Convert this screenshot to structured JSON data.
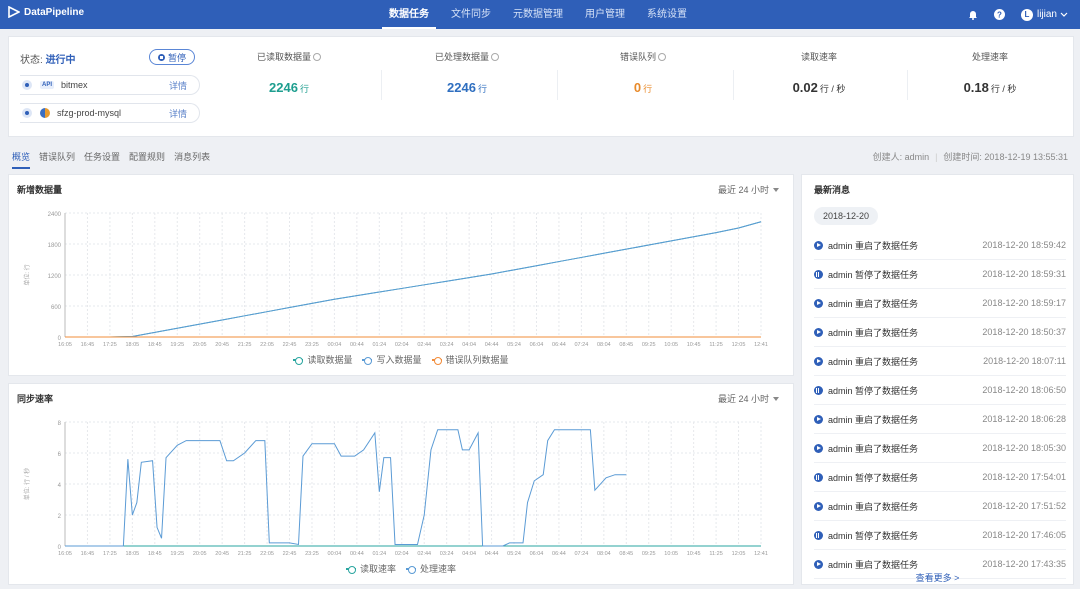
{
  "app": {
    "title": "DataPipeline"
  },
  "nav": {
    "items": [
      {
        "label": "数据任务",
        "active": true
      },
      {
        "label": "文件同步",
        "active": false
      },
      {
        "label": "元数据管理",
        "active": false
      },
      {
        "label": "用户管理",
        "active": false
      },
      {
        "label": "系统设置",
        "active": false
      }
    ],
    "user": "lijian"
  },
  "status": {
    "prefix": "状态:",
    "value": "进行中",
    "pause_label": "暂停",
    "sources": [
      {
        "badge": "API",
        "name": "bitmex",
        "detail": "详情"
      },
      {
        "name": "sfzg-prod-mysql",
        "detail": "详情"
      }
    ]
  },
  "metrics": [
    {
      "label": "已读取数据量",
      "value": "2246",
      "unit": "行",
      "color": "#1e9e8f",
      "info": true
    },
    {
      "label": "已处理数据量",
      "value": "2246",
      "unit": "行",
      "color": "#2f6fc0",
      "info": true
    },
    {
      "label": "错误队列",
      "value": "0",
      "unit": "行",
      "color": "#e88a2a",
      "info": true
    },
    {
      "label": "读取速率",
      "value": "0.02",
      "unit": "行 / 秒",
      "color": "#333333",
      "info": false
    },
    {
      "label": "处理速率",
      "value": "0.18",
      "unit": "行 / 秒",
      "color": "#333333",
      "info": false
    }
  ],
  "tabs": [
    "概览",
    "错误队列",
    "任务设置",
    "配置规则",
    "消息列表"
  ],
  "creator": {
    "creator": "创建人: admin",
    "created": "创建时间: 2018-12-19 13:55:31"
  },
  "chart1_panel": {
    "title": "新增数据量",
    "range": "最近 24 小时"
  },
  "chart2_panel": {
    "title": "同步速率",
    "range": "最近 24 小时"
  },
  "chart_data": [
    {
      "type": "line",
      "title": "新增数据量",
      "ylabel": "单位: 行",
      "ylim": [
        0,
        2400
      ],
      "yticks": [
        0,
        600,
        1200,
        1800,
        2400
      ],
      "x": [
        "16:05",
        "16:45",
        "17:25",
        "18:05",
        "18:45",
        "19:25",
        "20:05",
        "20:45",
        "21:25",
        "22:05",
        "22:45",
        "23:25",
        "00:04",
        "00:44",
        "01:24",
        "02:04",
        "02:44",
        "03:24",
        "04:04",
        "04:44",
        "05:24",
        "06:04",
        "06:44",
        "07:24",
        "08:04",
        "08:45",
        "09:25",
        "10:05",
        "10:45",
        "11:25",
        "12:05",
        "12:41"
      ],
      "grid": true,
      "legend": "bottom",
      "series": [
        {
          "name": "读取数据量",
          "color": "#2aa6a0",
          "values": [
            0,
            0,
            0,
            10,
            90,
            170,
            250,
            330,
            410,
            490,
            570,
            650,
            730,
            800,
            870,
            940,
            1010,
            1080,
            1150,
            1220,
            1300,
            1380,
            1460,
            1540,
            1620,
            1700,
            1780,
            1860,
            1940,
            2020,
            2110,
            2230
          ]
        },
        {
          "name": "写入数据量",
          "color": "#5b9bd5",
          "values": [
            0,
            0,
            0,
            10,
            90,
            170,
            250,
            330,
            410,
            490,
            570,
            650,
            730,
            800,
            870,
            940,
            1010,
            1080,
            1150,
            1220,
            1300,
            1380,
            1460,
            1540,
            1620,
            1700,
            1780,
            1860,
            1940,
            2020,
            2110,
            2230
          ]
        },
        {
          "name": "错误队列数据量",
          "color": "#f28c3a",
          "values": [
            0,
            0,
            0,
            0,
            0,
            0,
            0,
            0,
            0,
            0,
            0,
            0,
            0,
            0,
            0,
            0,
            0,
            0,
            0,
            0,
            0,
            0,
            0,
            0,
            0,
            0,
            0,
            0,
            0,
            0,
            0,
            0
          ]
        }
      ]
    },
    {
      "type": "line",
      "title": "同步速率",
      "ylabel": "单位: 行 / 秒",
      "ylim": [
        0,
        8
      ],
      "yticks": [
        0,
        2,
        4,
        6,
        8
      ],
      "x": [
        "16:05",
        "16:45",
        "17:25",
        "18:05",
        "18:45",
        "19:25",
        "20:05",
        "20:45",
        "21:25",
        "22:05",
        "22:45",
        "23:25",
        "00:04",
        "00:44",
        "01:24",
        "02:04",
        "02:44",
        "03:24",
        "04:04",
        "04:44",
        "05:24",
        "06:04",
        "06:44",
        "07:24",
        "08:04",
        "08:45",
        "09:25",
        "10:05",
        "10:45",
        "11:25",
        "12:05",
        "12:41"
      ],
      "grid": true,
      "legend": "bottom",
      "series": [
        {
          "name": "读取速率",
          "color": "#2aa6a0",
          "points": [
            [
              0,
              0
            ],
            [
              31,
              0
            ]
          ]
        },
        {
          "name": "处理速率",
          "color": "#5b9bd5",
          "points": [
            [
              0,
              0
            ],
            [
              2.6,
              0
            ],
            [
              2.8,
              5.6
            ],
            [
              3.0,
              2.0
            ],
            [
              3.2,
              2.8
            ],
            [
              3.4,
              5.4
            ],
            [
              3.9,
              5.5
            ],
            [
              4.1,
              1.2
            ],
            [
              4.3,
              0.5
            ],
            [
              4.5,
              5.7
            ],
            [
              5.0,
              6.5
            ],
            [
              5.4,
              6.8
            ],
            [
              6.5,
              6.8
            ],
            [
              6.9,
              6.8
            ],
            [
              7.2,
              5.5
            ],
            [
              7.5,
              5.5
            ],
            [
              8.0,
              6.0
            ],
            [
              8.5,
              6.8
            ],
            [
              8.9,
              6.8
            ],
            [
              9.1,
              0.2
            ],
            [
              10.0,
              0.2
            ],
            [
              10.4,
              0.1
            ],
            [
              10.6,
              5.8
            ],
            [
              11.0,
              6.6
            ],
            [
              12.0,
              6.6
            ],
            [
              12.3,
              5.8
            ],
            [
              12.9,
              5.8
            ],
            [
              13.3,
              6.2
            ],
            [
              13.8,
              7.3
            ],
            [
              14.0,
              3.5
            ],
            [
              14.2,
              5.7
            ],
            [
              14.5,
              5.7
            ],
            [
              14.7,
              0.1
            ],
            [
              15.7,
              0.1
            ],
            [
              16.0,
              2.0
            ],
            [
              16.3,
              6.2
            ],
            [
              16.6,
              7.5
            ],
            [
              17.5,
              7.5
            ],
            [
              17.7,
              6.2
            ],
            [
              18.0,
              6.2
            ],
            [
              18.4,
              7.3
            ],
            [
              18.6,
              0.0
            ],
            [
              19.5,
              0.0
            ],
            [
              19.8,
              0.2
            ],
            [
              20.4,
              0.2
            ],
            [
              20.6,
              2.8
            ],
            [
              20.9,
              4.2
            ],
            [
              21.3,
              4.6
            ],
            [
              21.5,
              6.8
            ],
            [
              21.8,
              7.5
            ],
            [
              23.4,
              7.5
            ],
            [
              23.6,
              3.6
            ],
            [
              24.1,
              4.4
            ],
            [
              24.5,
              4.6
            ],
            [
              25.0,
              4.6
            ]
          ]
        }
      ]
    }
  ],
  "news": {
    "title": "最新消息",
    "date": "2018-12-20",
    "items": [
      {
        "text": "admin 重启了数据任务",
        "time": "2018-12-20 18:59:42",
        "kind": "restart"
      },
      {
        "text": "admin 暂停了数据任务",
        "time": "2018-12-20 18:59:31",
        "kind": "pause"
      },
      {
        "text": "admin 重启了数据任务",
        "time": "2018-12-20 18:59:17",
        "kind": "restart"
      },
      {
        "text": "admin 重启了数据任务",
        "time": "2018-12-20 18:50:37",
        "kind": "restart"
      },
      {
        "text": "admin 重启了数据任务",
        "time": "2018-12-20 18:07:11",
        "kind": "restart"
      },
      {
        "text": "admin 暂停了数据任务",
        "time": "2018-12-20 18:06:50",
        "kind": "pause"
      },
      {
        "text": "admin 重启了数据任务",
        "time": "2018-12-20 18:06:28",
        "kind": "restart"
      },
      {
        "text": "admin 重启了数据任务",
        "time": "2018-12-20 18:05:30",
        "kind": "restart"
      },
      {
        "text": "admin 暂停了数据任务",
        "time": "2018-12-20 17:54:01",
        "kind": "pause"
      },
      {
        "text": "admin 重启了数据任务",
        "time": "2018-12-20 17:51:52",
        "kind": "restart"
      },
      {
        "text": "admin 暂停了数据任务",
        "time": "2018-12-20 17:46:05",
        "kind": "pause"
      },
      {
        "text": "admin 重启了数据任务",
        "time": "2018-12-20 17:43:35",
        "kind": "restart"
      }
    ],
    "more": "查看更多 >"
  }
}
